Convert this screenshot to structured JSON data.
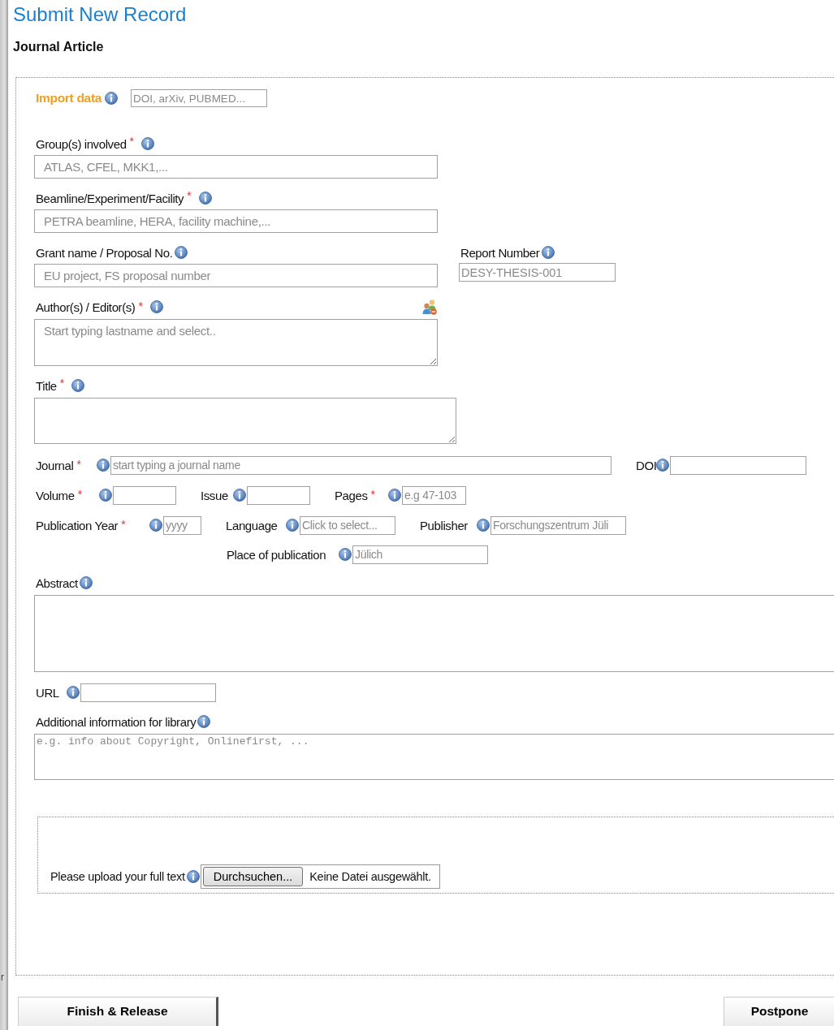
{
  "page": {
    "title": "Submit New Record",
    "subtitle": "Journal Article",
    "edge_text": "r"
  },
  "import": {
    "label": "Import data",
    "placeholder": "DOI, arXiv, PUBMED..."
  },
  "groups": {
    "label": "Group(s) involved",
    "mark": "*",
    "placeholder": "ATLAS, CFEL, MKK1,..."
  },
  "beamline": {
    "label": "Beamline/Experiment/Facility",
    "mark": "*",
    "placeholder": "PETRA beamline, HERA, facility machine,..."
  },
  "grant": {
    "label": "Grant name / Proposal No.",
    "placeholder": "EU project, FS proposal number"
  },
  "report_number": {
    "label": "Report Number",
    "placeholder": "DESY-THESIS-001"
  },
  "authors": {
    "label": "Author(s) / Editor(s)",
    "mark": "*",
    "placeholder": "Start typing lastname and select.."
  },
  "title_field": {
    "label": "Title",
    "mark": "*"
  },
  "journal": {
    "label": "Journal",
    "mark": "*",
    "placeholder": "start typing a journal name"
  },
  "doi": {
    "label": "DOI"
  },
  "volume": {
    "label": "Volume",
    "mark": "*"
  },
  "issue": {
    "label": "Issue"
  },
  "pages": {
    "label": "Pages",
    "mark": "*",
    "placeholder": "e.g 47-103"
  },
  "publication_year": {
    "label": "Publication Year",
    "mark": "*",
    "placeholder": "yyyy"
  },
  "language": {
    "label": "Language",
    "placeholder": "Click to select..."
  },
  "publisher": {
    "label": "Publisher",
    "placeholder": "Forschungszentrum Jüli"
  },
  "place": {
    "label": "Place of publication",
    "placeholder": "Jülich"
  },
  "abstract": {
    "label": "Abstract"
  },
  "url": {
    "label": "URL"
  },
  "additional_info": {
    "label": "Additional information for library",
    "placeholder": "e.g. info about Copyright, Onlinefirst, ..."
  },
  "upload": {
    "label": "Please upload your full text",
    "button": "Durchsuchen...",
    "status": "Keine Datei ausgewählt."
  },
  "buttons": [
    "Finish & Release",
    "Postpone"
  ]
}
